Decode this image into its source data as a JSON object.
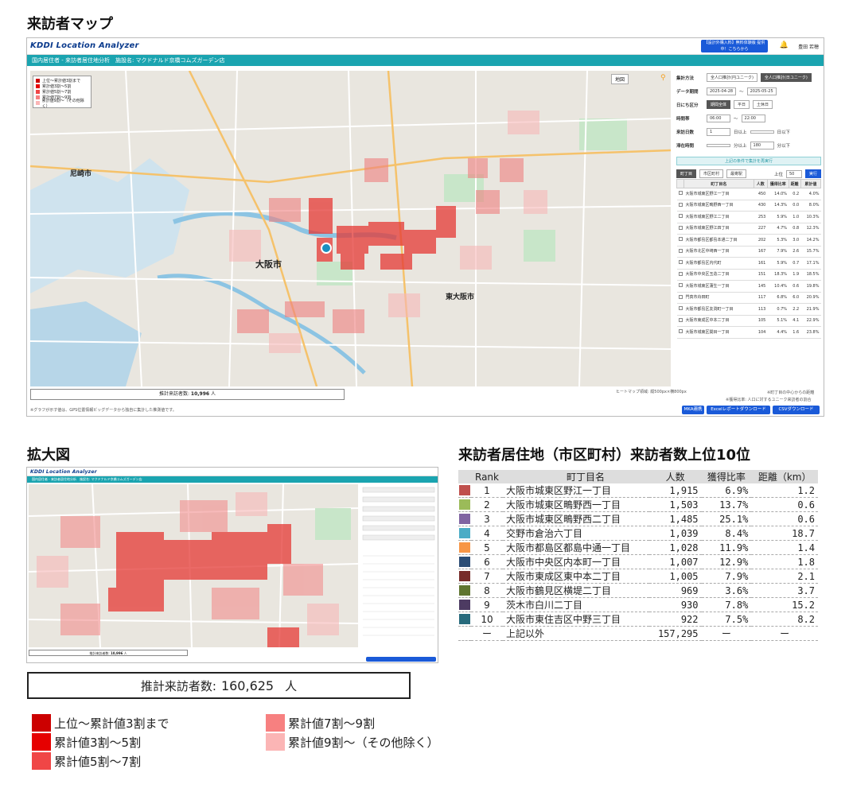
{
  "headings": {
    "map": "来訪者マップ",
    "zoom": "拡大図",
    "ranking": "来訪者居住地（市区町村）来訪者数上位10位"
  },
  "app": {
    "logo": "KDDI Location Analyzer",
    "promo": "【設計外購入料】無料体験版 提供中！こちらから",
    "user": "豊田 若穂",
    "subbar": "国内居住者 - 来訪者居住地分析　施設名: マクドナルド京橋コムズガーデン店",
    "map_type": "地図",
    "legend": [
      "上位〜累計値3割まで",
      "累計値3割〜5割",
      "累計値5割〜7割",
      "累計値7割〜9割",
      "累計値9割〜（その他除く）"
    ],
    "city_labels": [
      "大阪市",
      "東大阪市",
      "尼崎市"
    ],
    "total_label": "推計来訪者数",
    "total_value": "10,996",
    "total_unit": "人",
    "map_credit": "ヒートマップ領域: 縦500px×横800px",
    "footnote": "※グラフが示す値は、GPS位置情報ビッグデータから独自に集計した推測値です。",
    "panel": {
      "method_label": "集計方法",
      "method_opts": [
        "全人口推計(円ユニーク)",
        "全人口推計(日ユニーク)"
      ],
      "period_label": "データ期間",
      "date_from": "2025-04-28",
      "date_sep": "〜",
      "date_to": "2025-05-25",
      "day_label": "日にち区分",
      "day_opts": [
        "期間全体",
        "平日",
        "土休日"
      ],
      "time_label": "時間帯",
      "time_from": "06:00",
      "time_to": "22:00",
      "days_label": "来訪日数",
      "days_val": "1",
      "days_unit": "日以上",
      "days_unit2": "日以下",
      "stay_label": "滞在時間",
      "stay_unit": "分以上",
      "stay_val": "180",
      "stay_unit2": "分以下",
      "update_btn": "上記の条件で集計を再実行",
      "tabs": [
        "町丁目",
        "市区町村",
        "最寄駅"
      ],
      "top_label": "上位",
      "top_val": "50",
      "run": "実行",
      "cols": [
        "町丁目名",
        "人数",
        "獲得比率",
        "距離",
        "累計値"
      ],
      "rows": [
        [
          "大阪市城東区野江一丁目",
          "450",
          "14.0%",
          "0.2",
          "4.0%"
        ],
        [
          "大阪市城東区鴫野西一丁目",
          "430",
          "14.3%",
          "0.0",
          "8.0%"
        ],
        [
          "大阪市城東区野江二丁目",
          "253",
          "5.9%",
          "1.0",
          "10.3%"
        ],
        [
          "大阪市城東区野江四丁目",
          "227",
          "4.7%",
          "0.8",
          "12.3%"
        ],
        [
          "大阪市都島区都島本通二丁目",
          "202",
          "5.3%",
          "3.0",
          "14.2%"
        ],
        [
          "大阪市北区中崎西一丁目",
          "167",
          "7.9%",
          "2.6",
          "15.7%"
        ],
        [
          "大阪市都島区内代町",
          "161",
          "5.9%",
          "0.7",
          "17.1%"
        ],
        [
          "大阪市中央区玉造二丁目",
          "151",
          "18.3%",
          "1.9",
          "18.5%"
        ],
        [
          "大阪市城東区蒲生一丁目",
          "145",
          "10.4%",
          "0.6",
          "19.8%"
        ],
        [
          "門真市舟田町",
          "117",
          "6.8%",
          "6.0",
          "20.9%"
        ],
        [
          "大阪市都島区友渕町一丁目",
          "113",
          "0.7%",
          "2.2",
          "21.9%"
        ],
        [
          "大阪市東成区中本二丁目",
          "105",
          "5.1%",
          "4.1",
          "22.9%"
        ],
        [
          "大阪市城東区関目一丁目",
          "104",
          "4.4%",
          "1.6",
          "23.8%"
        ]
      ],
      "note1": "※町丁目の中心からの距離",
      "note2": "※獲得比率: 人口に対するユニーク来訪者の割合"
    },
    "buttons": [
      "MKA連携",
      "Excelレポートダウンロード",
      "CSVダウンロード"
    ]
  },
  "zoom": {
    "total_label": "推計来訪者数",
    "total_value": "10,996",
    "total_unit": "人"
  },
  "ranking": {
    "cols": [
      "Rank",
      "町丁目名",
      "人数",
      "獲得比率",
      "距離（km）"
    ],
    "rows": [
      {
        "rank": "1",
        "name": "大阪市城東区野江一丁目",
        "count": "1,915",
        "ratio": "6.9%",
        "dist": "1.2",
        "color": "#c0504d"
      },
      {
        "rank": "2",
        "name": "大阪市城東区鴫野西一丁目",
        "count": "1,503",
        "ratio": "13.7%",
        "dist": "0.6",
        "color": "#9bbb59"
      },
      {
        "rank": "3",
        "name": "大阪市城東区鴫野西二丁目",
        "count": "1,485",
        "ratio": "25.1%",
        "dist": "0.6",
        "color": "#8064a2"
      },
      {
        "rank": "4",
        "name": "交野市倉治六丁目",
        "count": "1,039",
        "ratio": "8.4%",
        "dist": "18.7",
        "color": "#4bacc6"
      },
      {
        "rank": "5",
        "name": "大阪市都島区都島中通一丁目",
        "count": "1,028",
        "ratio": "11.9%",
        "dist": "1.4",
        "color": "#f79646"
      },
      {
        "rank": "6",
        "name": "大阪市中央区内本町一丁目",
        "count": "1,007",
        "ratio": "12.9%",
        "dist": "1.8",
        "color": "#2c4d75"
      },
      {
        "rank": "7",
        "name": "大阪市東成区東中本二丁目",
        "count": "1,005",
        "ratio": "7.9%",
        "dist": "2.1",
        "color": "#772c2a"
      },
      {
        "rank": "8",
        "name": "大阪市鶴見区横堤二丁目",
        "count": "969",
        "ratio": "3.6%",
        "dist": "3.7",
        "color": "#5f7530"
      },
      {
        "rank": "9",
        "name": "茨木市白川二丁目",
        "count": "930",
        "ratio": "7.8%",
        "dist": "15.2",
        "color": "#4d3b62"
      },
      {
        "rank": "10",
        "name": "大阪市東住吉区中野三丁目",
        "count": "922",
        "ratio": "7.5%",
        "dist": "8.2",
        "color": "#276a7c"
      },
      {
        "rank": "ー",
        "name": "上記以外",
        "count": "157,295",
        "ratio": "ー",
        "dist": "ー",
        "color": ""
      }
    ]
  },
  "total": {
    "label": "推計来訪者数:",
    "value": "160,625",
    "unit": "人"
  },
  "legend": {
    "items": [
      {
        "label": "上位〜累計値3割まで",
        "color": "#cc0000"
      },
      {
        "label": "累計値3割〜5割",
        "color": "#e60000"
      },
      {
        "label": "累計値5割〜7割",
        "color": "#f04646"
      },
      {
        "label": "累計値7割〜9割",
        "color": "#f78080"
      },
      {
        "label": "累計値9割〜（その他除く）",
        "color": "#fbb5b5"
      }
    ]
  }
}
